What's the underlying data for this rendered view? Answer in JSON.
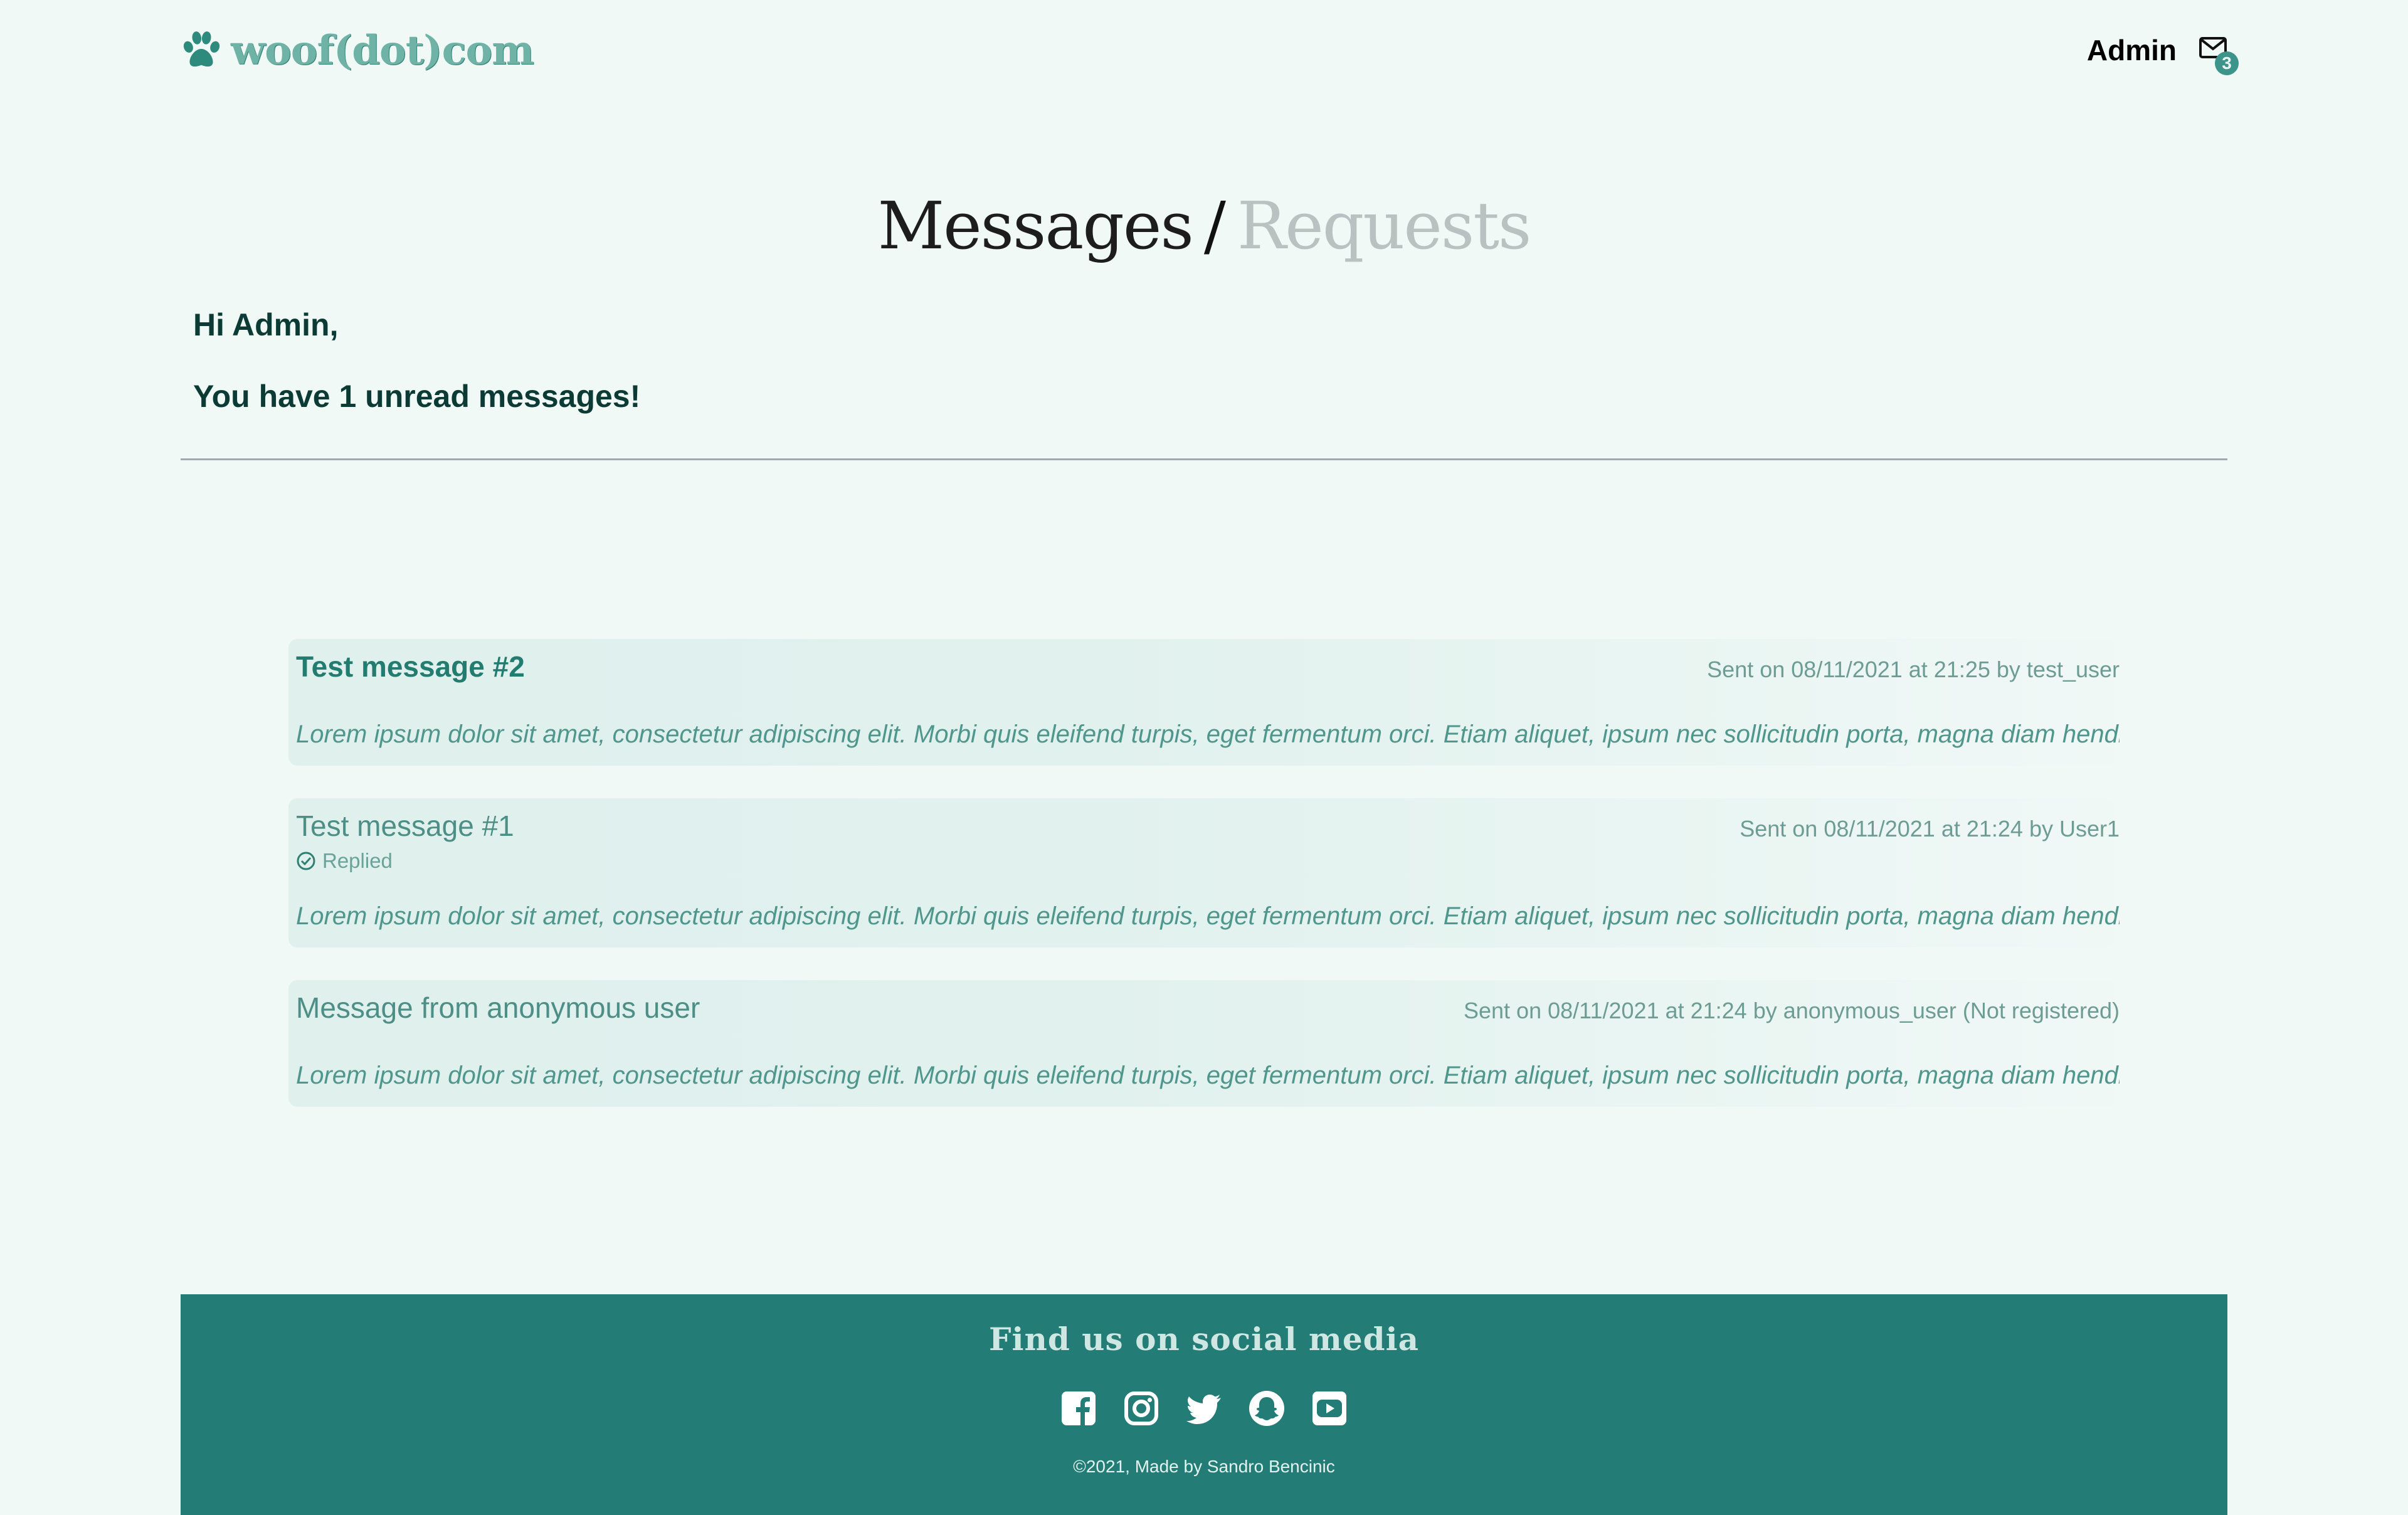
{
  "header": {
    "logo_text": "woof(dot)com",
    "user_label": "Admin",
    "mail_badge_count": "3"
  },
  "page": {
    "title_active": "Messages",
    "title_separator": "/",
    "title_inactive": "Requests",
    "greeting": "Hi Admin,",
    "unread_notice": "You have 1 unread messages!"
  },
  "messages": [
    {
      "title": "Test message #2",
      "meta": "Sent on 08/11/2021 at 21:25 by test_user",
      "body": "Lorem ipsum dolor sit amet, consectetur adipiscing elit. Morbi quis eleifend turpis, eget fermentum orci. Etiam aliquet, ipsum nec sollicitudin porta, magna diam hendrerit",
      "unread": true
    },
    {
      "title": "Test message #1",
      "meta": "Sent on 08/11/2021 at 21:24 by User1",
      "status": "Replied",
      "body": "Lorem ipsum dolor sit amet, consectetur adipiscing elit. Morbi quis eleifend turpis, eget fermentum orci. Etiam aliquet, ipsum nec sollicitudin porta, magna diam hendrerit",
      "unread": false
    },
    {
      "title": "Message from anonymous user",
      "meta": "Sent on 08/11/2021 at 21:24 by anonymous_user (Not registered)",
      "body": "Lorem ipsum dolor sit amet, consectetur adipiscing elit. Morbi quis eleifend turpis, eget fermentum orci. Etiam aliquet, ipsum nec sollicitudin porta, magna diam hendrerit",
      "unread": false
    }
  ],
  "footer": {
    "title": "Find us on social media",
    "socials": [
      "facebook-icon",
      "instagram-icon",
      "twitter-icon",
      "snapchat-icon",
      "youtube-icon"
    ],
    "copyright": "©2021, Made by Sandro Bencinic"
  },
  "colors": {
    "background": "#f1f9f7",
    "accent": "#237c75",
    "message_card": "#dff0ed",
    "dark_text": "#0c3b35"
  }
}
